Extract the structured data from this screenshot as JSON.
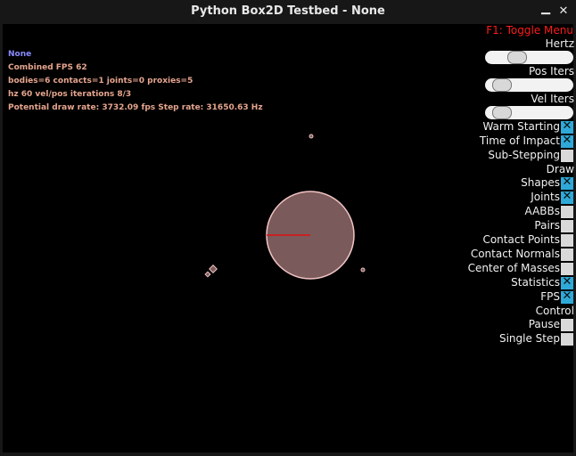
{
  "window": {
    "title": "Python Box2D Testbed - None"
  },
  "stats": {
    "test_name": "None",
    "fps": "Combined FPS 62",
    "counts": "bodies=6 contacts=1 joints=0 proxies=5",
    "iterations": "hz 60 vel/pos iterations 8/3",
    "rates": "Potential draw rate: 3732.09 fps Step rate: 31650.63 Hz"
  },
  "menu": {
    "toggle": "F1: Toggle Menu",
    "hertz": {
      "label": "Hertz",
      "value_fraction": 0.33
    },
    "pos_iters": {
      "label": "Pos Iters",
      "value_fraction": 0.1
    },
    "vel_iters": {
      "label": "Vel Iters",
      "value_fraction": 0.1
    },
    "checkboxes": [
      {
        "label": "Warm Starting",
        "checked": true
      },
      {
        "label": "Time of Impact",
        "checked": true
      },
      {
        "label": "Sub-Stepping",
        "checked": false
      }
    ],
    "draw_header": "Draw",
    "draw_checkboxes": [
      {
        "label": "Shapes",
        "checked": true
      },
      {
        "label": "Joints",
        "checked": true
      },
      {
        "label": "AABBs",
        "checked": false
      },
      {
        "label": "Pairs",
        "checked": false
      },
      {
        "label": "Contact Points",
        "checked": false
      },
      {
        "label": "Contact Normals",
        "checked": false
      },
      {
        "label": "Center of Masses",
        "checked": false
      },
      {
        "label": "Statistics",
        "checked": true
      },
      {
        "label": "FPS",
        "checked": true
      }
    ],
    "control_header": "Control",
    "control_checkboxes": [
      {
        "label": "Pause",
        "checked": false
      },
      {
        "label": "Single Step",
        "checked": false
      }
    ]
  },
  "colors": {
    "body_fill": "#7a5a5a",
    "body_outline": "#f2c4c4",
    "axis_line": "#e01010"
  }
}
